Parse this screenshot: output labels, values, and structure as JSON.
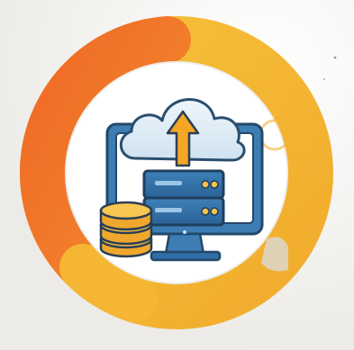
{
  "illustration": {
    "icons": [
      "progress-ring",
      "computer-monitor-icon",
      "cloud-icon",
      "upload-arrow-icon",
      "server-rack-icon",
      "database-coins-icon"
    ],
    "colors": {
      "background": "#f4f4f2",
      "ring_orange": "#f07a2a",
      "ring_yellow": "#f6b733",
      "inner_disc": "#ffffff",
      "monitor_blue": "#3f7fb5",
      "monitor_outline": "#2a4e6f",
      "cloud": "#dceaf4",
      "arrow": "#f5a623",
      "server": "#2f6ea5",
      "coins": "#f3b53a"
    }
  }
}
